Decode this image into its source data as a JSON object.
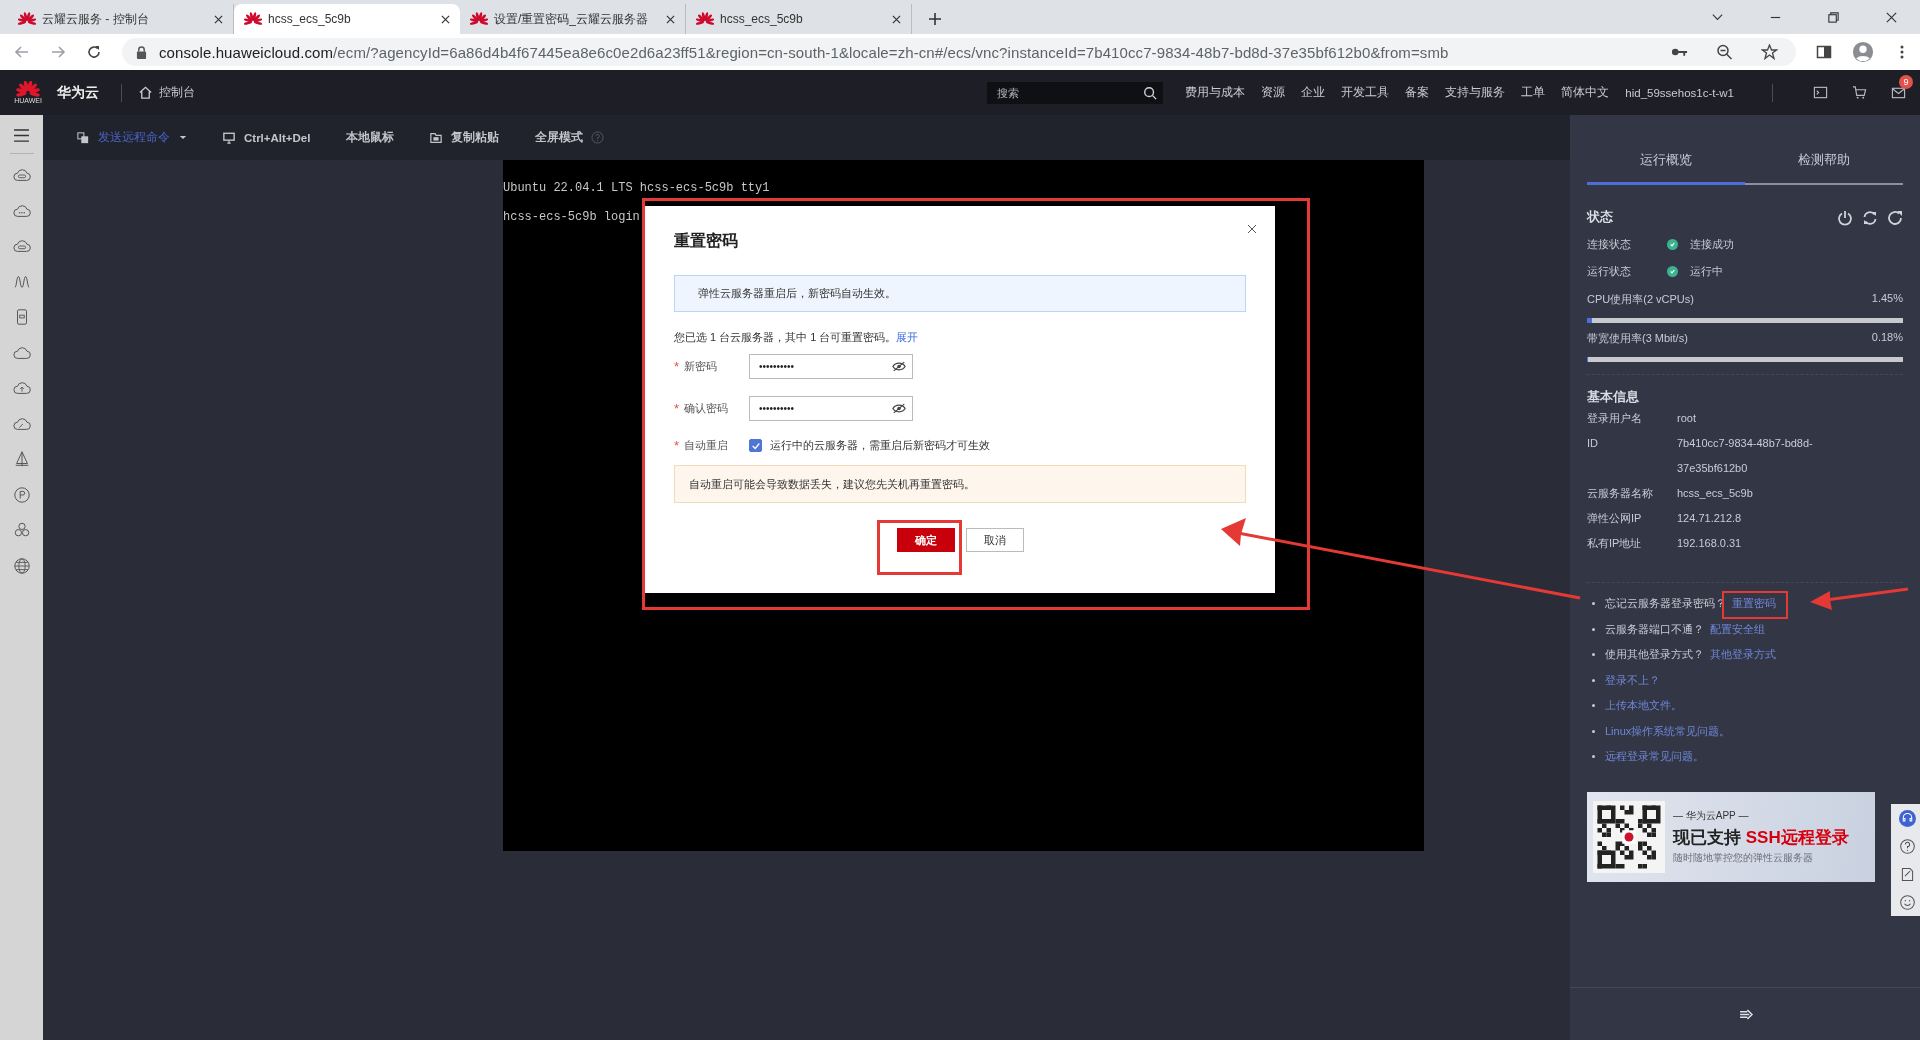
{
  "browser_tabs": [
    {
      "title": "云耀云服务 - 控制台",
      "selected": false
    },
    {
      "title": "hcss_ecs_5c9b",
      "selected": true
    },
    {
      "title": "设置/重置密码_云耀云服务器",
      "selected": false
    },
    {
      "title": "hcss_ecs_5c9b",
      "selected": false
    }
  ],
  "address_bar": {
    "host": "console.huaweicloud.com",
    "path": "/ecm/?agencyId=6a86d4b4f67445ea8e6c0e2d6a23ff51&region=cn-south-1&locale=zh-cn#/ecs/vnc?instanceId=7b410cc7-9834-48b7-bd8d-37e35bf612b0&from=smb"
  },
  "console_header": {
    "logo_text": "HUAWEI",
    "brand": "华为云",
    "home": "控制台",
    "search": {
      "placeholder": "搜索"
    },
    "nav": [
      "费用与成本",
      "资源",
      "企业",
      "开发工具",
      "备案",
      "支持与服务",
      "工单",
      "简体中文",
      "hid_59ssehos1c-t-w1"
    ],
    "message_badge": "9"
  },
  "toolbar": [
    {
      "label": "发送远程命令",
      "kind": "dropdown"
    },
    {
      "label": "Ctrl+Alt+Del",
      "kind": "monitor"
    },
    {
      "label": "本地鼠标",
      "kind": "plain"
    },
    {
      "label": "复制粘贴",
      "kind": "folder"
    },
    {
      "label": "全屏模式",
      "kind": "help"
    }
  ],
  "terminal": {
    "lines": [
      "Ubuntu 22.04.1 LTS hcss-ecs-5c9b tty1",
      "hcss-ecs-5c9b login"
    ]
  },
  "dialog": {
    "title": "重置密码",
    "required_mark": "*",
    "info": "弹性云服务器重启后，新密码自动生效。",
    "selection_text": "您已选 1 台云服务器，其中 1 台可重置密码。",
    "expand_link": "展开",
    "fields": [
      {
        "label": "新密码",
        "required": true,
        "value": "••••••••••"
      },
      {
        "label": "确认密码",
        "required": true,
        "value": "••••••••••"
      }
    ],
    "auto_restart": {
      "label": "自动重启",
      "required": true,
      "checked": true,
      "text": "运行中的云服务器，需重启后新密码才可生效"
    },
    "warning": "自动重启可能会导致数据丢失，建议您先关机再重置密码。",
    "buttons": [
      {
        "label": "确定",
        "kind": "primary"
      },
      {
        "label": "取消",
        "kind": "secondary"
      }
    ]
  },
  "side_panel": {
    "tabs": [
      {
        "label": "运行概览",
        "selected": true
      },
      {
        "label": "检测帮助",
        "selected": false
      }
    ],
    "status": {
      "title": "状态",
      "rows": [
        {
          "label": "连接状态",
          "value": "连接成功",
          "color": "#3bb38f"
        },
        {
          "label": "运行状态",
          "value": "运行中",
          "color": "#3bb38f"
        }
      ],
      "meters": [
        {
          "label": "CPU使用率(2 vCPUs)",
          "reading": "1.45%",
          "level": 0.0145
        },
        {
          "label": "带宽使用率(3 Mbit/s)",
          "reading": "0.18%",
          "level": 0.0018
        }
      ]
    },
    "basic_info": {
      "title": "基本信息",
      "rows": [
        {
          "label": "登录用户名",
          "value": "root"
        },
        {
          "label": "ID",
          "value": "7b410cc7-9834-48b7-bd8d-37e35bf612b0"
        },
        {
          "label": "云服务器名称",
          "value": "hcss_ecs_5c9b"
        },
        {
          "label": "弹性公网IP",
          "value": "124.71.212.8"
        },
        {
          "label": "私有IP地址",
          "value": "192.168.0.31"
        }
      ]
    },
    "help": [
      {
        "text": "忘记云服务器登录密码？",
        "link": "重置密码"
      },
      {
        "text": "云服务器端口不通？",
        "link": "配置安全组"
      },
      {
        "text": "使用其他登录方式？",
        "link": "其他登录方式"
      },
      {
        "link": "登录不上？"
      },
      {
        "link": "上传本地文件。"
      },
      {
        "link": "Linux操作系统常见问题。"
      },
      {
        "link": "远程登录常见问题。"
      }
    ],
    "promo": {
      "kicker": "— 华为云APP —",
      "headline": "现已支持 ",
      "highlight": "SSH远程登录",
      "subline": "随时随地掌控您的弹性云服务器"
    }
  }
}
